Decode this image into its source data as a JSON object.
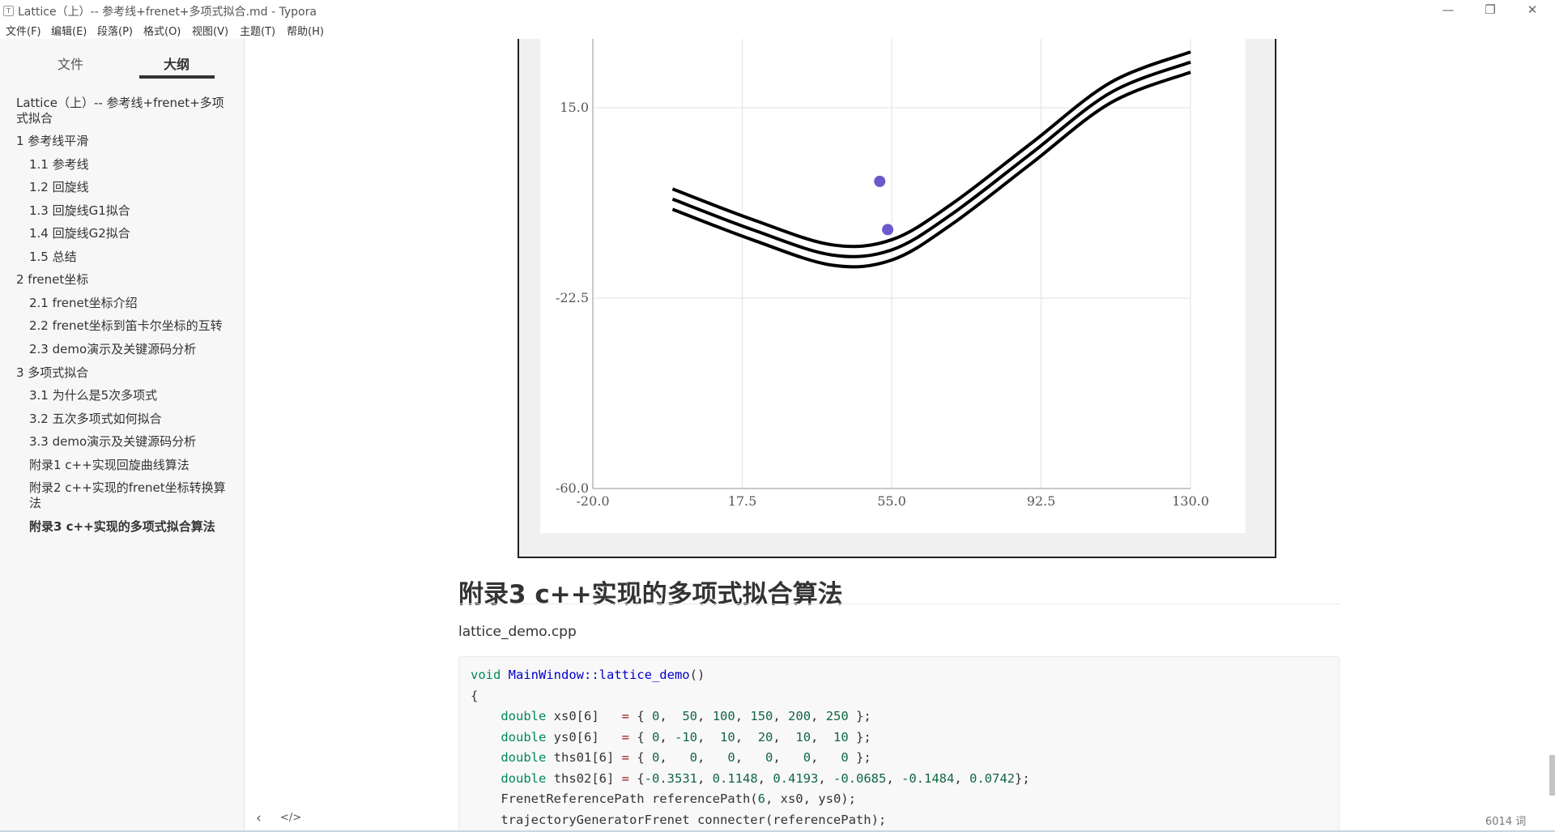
{
  "window": {
    "app_icon": "T",
    "title": "Lattice（上）-- 参考线+frenet+多项式拟合.md - Typora",
    "minimize_icon": "—",
    "maximize_icon": "❐",
    "close_icon": "✕"
  },
  "menu": [
    "文件(F)",
    "编辑(E)",
    "段落(P)",
    "格式(O)",
    "视图(V)",
    "主题(T)",
    "帮助(H)"
  ],
  "sidebar": {
    "tab_files": "文件",
    "tab_outline": "大纲",
    "outline": [
      {
        "label": "Lattice（上）-- 参考线+frenet+多项式拟合",
        "level": 1
      },
      {
        "label": "1 参考线平滑",
        "level": 1
      },
      {
        "label": "1.1 参考线",
        "level": 2
      },
      {
        "label": "1.2 回旋线",
        "level": 2
      },
      {
        "label": "1.3 回旋线G1拟合",
        "level": 2
      },
      {
        "label": "1.4 回旋线G2拟合",
        "level": 2
      },
      {
        "label": "1.5 总结",
        "level": 2
      },
      {
        "label": "2 frenet坐标",
        "level": 1
      },
      {
        "label": "2.1 frenet坐标介绍",
        "level": 2
      },
      {
        "label": "2.2 frenet坐标到笛卡尔坐标的互转",
        "level": 2
      },
      {
        "label": "2.3 demo演示及关键源码分析",
        "level": 2
      },
      {
        "label": "3 多项式拟合",
        "level": 1
      },
      {
        "label": "3.1 为什么是5次多项式",
        "level": 2
      },
      {
        "label": "3.2 五次多项式如何拟合",
        "level": 2
      },
      {
        "label": "3.3 demo演示及关键源码分析",
        "level": 2
      },
      {
        "label": "附录1 c++实现回旋曲线算法",
        "level": 2
      },
      {
        "label": "附录2 c++实现的frenet坐标转换算法",
        "level": 2
      },
      {
        "label": "附录3 c++实现的多项式拟合算法",
        "level": 2,
        "active": true
      }
    ],
    "footer_left_icon": "‹",
    "footer_source_icon": "</>"
  },
  "chart_data": {
    "type": "line",
    "xlim": [
      -20.0,
      130.0
    ],
    "ylim": [
      -60.0,
      52.5
    ],
    "x_ticks": [
      "-20.0",
      "17.5",
      "55.0",
      "92.5",
      "130.0"
    ],
    "y_ticks": [
      "15.0",
      "-22.5",
      "-60.0"
    ],
    "grid": true,
    "series": [
      {
        "values": [
          [
            0,
            -1
          ],
          [
            20,
            -7
          ],
          [
            40,
            -12
          ],
          [
            55,
            -11
          ],
          [
            70,
            -4
          ],
          [
            90,
            8
          ],
          [
            110,
            20
          ],
          [
            130,
            26
          ]
        ]
      },
      {
        "values": [
          [
            0,
            -3
          ],
          [
            20,
            -9
          ],
          [
            40,
            -14
          ],
          [
            55,
            -13
          ],
          [
            70,
            -6
          ],
          [
            90,
            6
          ],
          [
            110,
            18
          ],
          [
            130,
            24
          ]
        ]
      },
      {
        "values": [
          [
            0,
            -5
          ],
          [
            20,
            -11
          ],
          [
            40,
            -16
          ],
          [
            55,
            -15
          ],
          [
            70,
            -8
          ],
          [
            90,
            4
          ],
          [
            110,
            16
          ],
          [
            130,
            22
          ]
        ]
      }
    ],
    "points": [
      [
        52,
        0.5
      ],
      [
        54,
        -9
      ]
    ],
    "point_color": "#6a5acd",
    "line_color": "#000000"
  },
  "content": {
    "heading": "附录3  c++实现的多项式拟合算法",
    "filename": "lattice_demo.cpp",
    "code": [
      [
        {
          "t": "void ",
          "c": "kw"
        },
        {
          "t": "MainWindow::lattice_demo",
          "c": "fn"
        },
        {
          "t": "()",
          "c": ""
        }
      ],
      [
        {
          "t": "{",
          "c": ""
        }
      ],
      [
        {
          "t": "    double ",
          "c": "kw"
        },
        {
          "t": "xs0[6]   ",
          "c": ""
        },
        {
          "t": "= ",
          "c": "op"
        },
        {
          "t": "{ ",
          "c": ""
        },
        {
          "t": "0",
          "c": "num"
        },
        {
          "t": ",  ",
          "c": ""
        },
        {
          "t": "50",
          "c": "num"
        },
        {
          "t": ", ",
          "c": ""
        },
        {
          "t": "100",
          "c": "num"
        },
        {
          "t": ", ",
          "c": ""
        },
        {
          "t": "150",
          "c": "num"
        },
        {
          "t": ", ",
          "c": ""
        },
        {
          "t": "200",
          "c": "num"
        },
        {
          "t": ", ",
          "c": ""
        },
        {
          "t": "250",
          "c": "num"
        },
        {
          "t": " };",
          "c": ""
        }
      ],
      [
        {
          "t": "    double ",
          "c": "kw"
        },
        {
          "t": "ys0[6]   ",
          "c": ""
        },
        {
          "t": "= ",
          "c": "op"
        },
        {
          "t": "{ ",
          "c": ""
        },
        {
          "t": "0",
          "c": "num"
        },
        {
          "t": ", ",
          "c": ""
        },
        {
          "t": "-10",
          "c": "num"
        },
        {
          "t": ",  ",
          "c": ""
        },
        {
          "t": "10",
          "c": "num"
        },
        {
          "t": ",  ",
          "c": ""
        },
        {
          "t": "20",
          "c": "num"
        },
        {
          "t": ",  ",
          "c": ""
        },
        {
          "t": "10",
          "c": "num"
        },
        {
          "t": ",  ",
          "c": ""
        },
        {
          "t": "10",
          "c": "num"
        },
        {
          "t": " };",
          "c": ""
        }
      ],
      [
        {
          "t": "    double ",
          "c": "kw"
        },
        {
          "t": "ths01[6] ",
          "c": ""
        },
        {
          "t": "= ",
          "c": "op"
        },
        {
          "t": "{ ",
          "c": ""
        },
        {
          "t": "0",
          "c": "num"
        },
        {
          "t": ",   ",
          "c": ""
        },
        {
          "t": "0",
          "c": "num"
        },
        {
          "t": ",   ",
          "c": ""
        },
        {
          "t": "0",
          "c": "num"
        },
        {
          "t": ",   ",
          "c": ""
        },
        {
          "t": "0",
          "c": "num"
        },
        {
          "t": ",   ",
          "c": ""
        },
        {
          "t": "0",
          "c": "num"
        },
        {
          "t": ",   ",
          "c": ""
        },
        {
          "t": "0",
          "c": "num"
        },
        {
          "t": " };",
          "c": ""
        }
      ],
      [
        {
          "t": "    double ",
          "c": "kw"
        },
        {
          "t": "ths02[6] ",
          "c": ""
        },
        {
          "t": "= ",
          "c": "op"
        },
        {
          "t": "{",
          "c": ""
        },
        {
          "t": "-0.3531",
          "c": "num"
        },
        {
          "t": ", ",
          "c": ""
        },
        {
          "t": "0.1148",
          "c": "num"
        },
        {
          "t": ", ",
          "c": ""
        },
        {
          "t": "0.4193",
          "c": "num"
        },
        {
          "t": ", ",
          "c": ""
        },
        {
          "t": "-0.0685",
          "c": "num"
        },
        {
          "t": ", ",
          "c": ""
        },
        {
          "t": "-0.1484",
          "c": "num"
        },
        {
          "t": ", ",
          "c": ""
        },
        {
          "t": "0.0742",
          "c": "num"
        },
        {
          "t": "};",
          "c": ""
        }
      ],
      [
        {
          "t": "    FrenetReferencePath referencePath(",
          "c": ""
        },
        {
          "t": "6",
          "c": "num"
        },
        {
          "t": ", xs0, ys0);",
          "c": ""
        }
      ],
      [
        {
          "t": "    trajectoryGeneratorFrenet connecter(referencePath);",
          "c": ""
        }
      ]
    ]
  },
  "status": {
    "word_count": "6014 词"
  }
}
